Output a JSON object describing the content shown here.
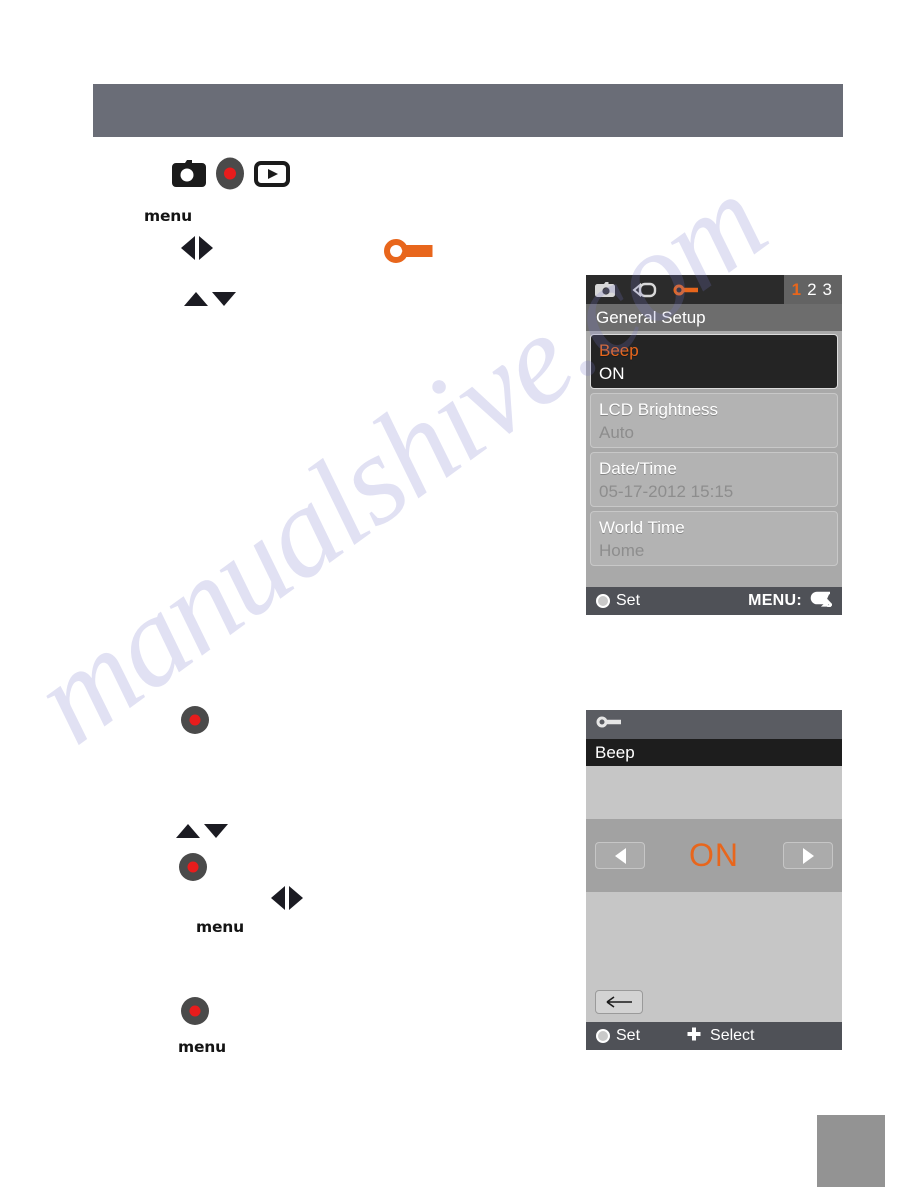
{
  "page": {
    "watermark_text": "manualshive.com",
    "header_band_color": "#6a6d77",
    "corner_block_color": "#939393",
    "accent_orange": "#e8661c"
  },
  "instructions": {
    "mode_icons": [
      {
        "name": "photo-camera-icon",
        "label": "photo-camera"
      },
      {
        "name": "record-dot-icon",
        "label": "record"
      },
      {
        "name": "playback-icon",
        "label": "playback"
      }
    ],
    "menu_label_1": "menu",
    "menu_label_2": "menu",
    "menu_label_3": "menu",
    "left_right_arrows": {
      "left": "◀",
      "right": "▶"
    },
    "up_down_arrows": {
      "up": "▲",
      "down": "▼"
    },
    "wrench_icon_name": "wrench-icon"
  },
  "screen_general_setup": {
    "tabs": [
      {
        "name": "tab-photo",
        "icon": "photo-camera-icon"
      },
      {
        "name": "tab-video",
        "icon": "video-camera-icon"
      },
      {
        "name": "tab-setup",
        "icon": "wrench-icon"
      }
    ],
    "page_numbers": [
      {
        "label": "1",
        "active": true
      },
      {
        "label": "2",
        "active": false
      },
      {
        "label": "3",
        "active": false
      }
    ],
    "title": "General Setup",
    "items": [
      {
        "label": "Beep",
        "value": "ON",
        "selected": true
      },
      {
        "label": "LCD Brightness",
        "value": "Auto",
        "selected": false
      },
      {
        "label": "Date/Time",
        "value": "05-17-2012 15:15",
        "selected": false
      },
      {
        "label": "World Time",
        "value": "Home",
        "selected": false
      }
    ],
    "footer": {
      "set_label": "Set",
      "menu_label": "MENU:"
    }
  },
  "screen_beep_detail": {
    "header_icon": "wrench-icon",
    "subtitle": "Beep",
    "value": "ON",
    "prev_arrow": "◀",
    "next_arrow": "▶",
    "back_arrow": "←",
    "footer": {
      "set_label": "Set",
      "select_label": "Select"
    }
  }
}
